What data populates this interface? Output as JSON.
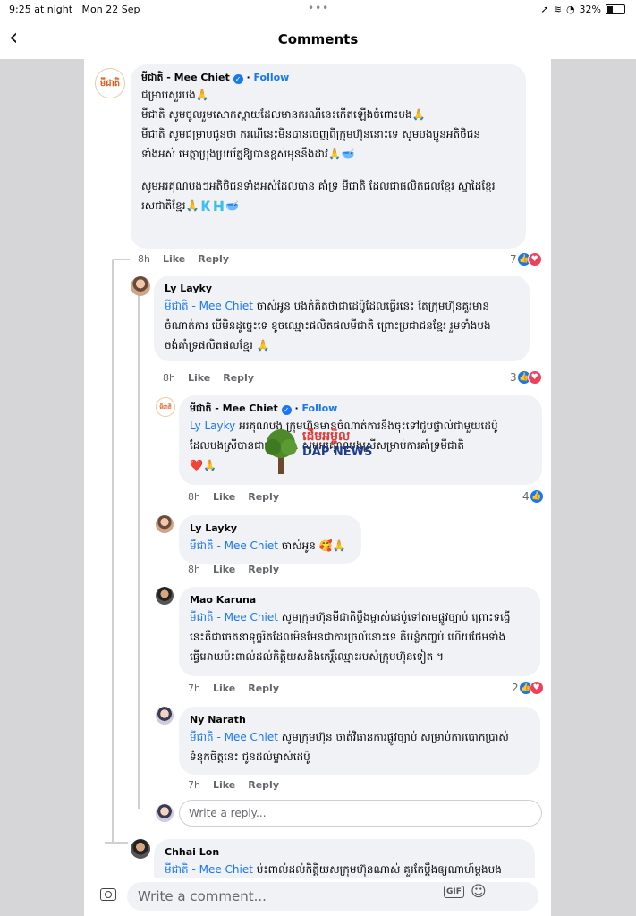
{
  "status": {
    "time": "9:25 at night",
    "date": "Mon 22 Sep",
    "dots": "•••",
    "battery": "32%",
    "icons": [
      "location-icon",
      "wifi-icon",
      "alarm-icon"
    ]
  },
  "nav": {
    "back_icon": "chevron-left-icon",
    "title": "Comments"
  },
  "comments": [
    {
      "author": "មីជាតិ - Mee Chiet",
      "follow": "Follow",
      "avatar_text": "មីជាតិ",
      "lines": [
        "ជម្រាបសួរបង🙏",
        "មីជាតិ សូមចូលរួមសោកស្តាយដែលមានករណីនេះកើតឡើងចំពោះបង🙏",
        "មីជាតិ សូមជម្រាបជូនថា ករណីនេះមិនបានចេញពីក្រុមហ៊ុននោះទេ សូមបងប្អូនអតិថិជន",
        "ទាំងអស់ មេត្តាប្រុងប្រយ័ត្នឱ្យបានខ្ពស់មុននឹងដាវ🙏🥣",
        "",
        "សូមអរគុណបងៗអតិថិជនទាំងអស់ដែលបាន គាំទ្រ មីជាតិ ដែលជាផលិតផលខ្មែរ ស្នាដៃខ្មែរ",
        "រសជាតិខ្មែរ🙏🇰🇭🥣"
      ],
      "time": "8h",
      "like": "Like",
      "reply": "Reply",
      "reactions": "7"
    },
    {
      "author": "Ly Layky",
      "mention": "មីជាតិ - Mee Chiet",
      "lines": [
        " ចាស់អូន បងកំគិតថាជាដេប៉ូដែលធ្វើរនេះ តែក្រុមហ៊ុនគួរមាន",
        "ចំណាត់ការ បើមិនដូច្នេះទេ ខូចឈ្មោះផលិតផលមីជាតិ ព្រោះប្រជាជនខ្មែរ រួមទាំងបង",
        "ចង់គាំទ្រផលិតផលខ្មែរ 🙏"
      ],
      "time": "8h",
      "like": "Like",
      "reply": "Reply",
      "reactions": "3"
    },
    {
      "author": "មីជាតិ - Mee Chiet",
      "follow": "Follow",
      "mention": "Ly Layky",
      "lines": [
        " អរគុណបង ក្រុមហ៊ុនមានចំណាត់ការនឹងចុះទៅជួបផ្ទាល់ជាមួយដេប៉ូ",
        "ដែលបងស្រីបានជាប ... ... សូមអរគុណបងស្រីសម្រាប់ការគាំទ្រមីជាតិ",
        "❤️🙏"
      ],
      "time": "8h",
      "like": "Like",
      "reply": "Reply",
      "reactions": "4"
    },
    {
      "author": "Ly Layky",
      "mention": "មីជាតិ - Mee Chiet",
      "lines": [
        " ចាស់អូន 🥰🙏"
      ],
      "time": "8h",
      "like": "Like",
      "reply": "Reply"
    },
    {
      "author": "Mao Karuna",
      "mention": "មីជាតិ - Mee Chiet",
      "lines": [
        " សូមក្រុមហ៊ុនមីជាតិប្តឹងម្ចាស់ដេប៉ូទៅតាមផ្លូវច្បាប់ ព្រោះទង្វើ",
        "នេះគឺជាចេតនាទុច្ចរិតដែលមិនមែនជាការច្រលំនោះទេ គឺបន្លំកញ្ចប់ ហើយថែមទាំង",
        "ធ្វើអោយប៉ះពាល់ដល់កិត្តិយសនិងកេរ្តិ៍ឈ្មោះរបស់ក្រុមហ៊ុនទៀត ។"
      ],
      "time": "7h",
      "like": "Like",
      "reply": "Reply",
      "reactions": "2"
    },
    {
      "author": "Ny Narath",
      "mention": "មីជាតិ - Mee Chiet",
      "lines": [
        " សូមក្រុមហ៊ុន ចាត់វិធានការផ្លូវច្បាប់ សម្រាប់ការបោកប្រាស់",
        "ទំនុកចិត្តនេះ ជូនដល់ម្ចាស់ដេប៉ូ"
      ],
      "time": "7h",
      "like": "Like",
      "reply": "Reply"
    },
    {
      "author": "Chhai Lon",
      "mention": "មីជាតិ - Mee Chiet",
      "lines": [
        " ប៉ះពាល់ដល់កិត្តិយសក្រុមហ៊ុនណាស់ គួរតែប្តឹងឲ្យណាហ៍ម្ដងបង"
      ]
    }
  ],
  "reply_placeholder": "Write a reply...",
  "watermark": {
    "title": "ដើមអម្ពិល",
    "subtitle": "DAP NEWS"
  },
  "comment_bar": {
    "placeholder": "Write a comment...",
    "gif": "GIF",
    "camera_icon": "camera-icon",
    "emoji_icon": "emoji-icon"
  }
}
